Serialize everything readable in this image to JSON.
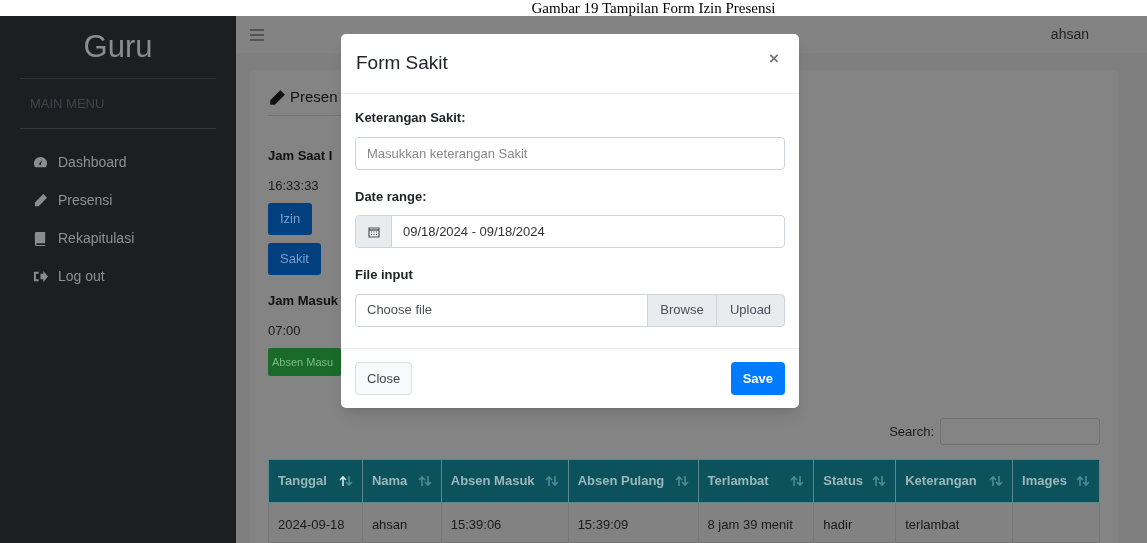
{
  "caption": "Gambar 19 Tampilan Form Izin Presensi",
  "sidebar": {
    "brand": "Guru",
    "section": "MAIN MENU",
    "items": [
      {
        "label": "Dashboard"
      },
      {
        "label": "Presensi"
      },
      {
        "label": "Rekapitulasi"
      },
      {
        "label": "Log out"
      }
    ]
  },
  "topbar": {
    "user": "ahsan"
  },
  "page": {
    "title": "Presen",
    "clock_label": "Jam Saat I",
    "clock": "16:33:33",
    "buttons": [
      {
        "label": "Izin"
      },
      {
        "label": "Sakit"
      }
    ],
    "jam_masuk_label": "Jam Masuk",
    "jam_masuk": "07:00",
    "absen_masuk": "Absen Masu",
    "search_label": "Search:",
    "table": {
      "columns": [
        {
          "label": "Tanggal",
          "sorted": true
        },
        {
          "label": "Nama",
          "sorted": false
        },
        {
          "label": "Absen Masuk",
          "sorted": false
        },
        {
          "label": "Absen Pulang",
          "sorted": false
        },
        {
          "label": "Terlambat",
          "sorted": false
        },
        {
          "label": "Status",
          "sorted": false
        },
        {
          "label": "Keterangan",
          "sorted": false
        },
        {
          "label": "Images",
          "sorted": false
        }
      ],
      "rows": [
        [
          "2024-09-18",
          "ahsan",
          "15:39:06",
          "15:39:09",
          "8 jam 39 menit",
          "hadir",
          "terlambat"
        ]
      ]
    }
  },
  "modal": {
    "title": "Form Sakit",
    "close_glyph": "×",
    "keterangan_label": "Keterangan Sakit:",
    "keterangan_placeholder": "Masukkan keterangan Sakit",
    "date_label": "Date range:",
    "date_value": "09/18/2024 - 09/18/2024",
    "file_label": "File input",
    "file_placeholder": "Choose file",
    "browse": "Browse",
    "upload": "Upload",
    "close": "Close",
    "save": "Save"
  }
}
